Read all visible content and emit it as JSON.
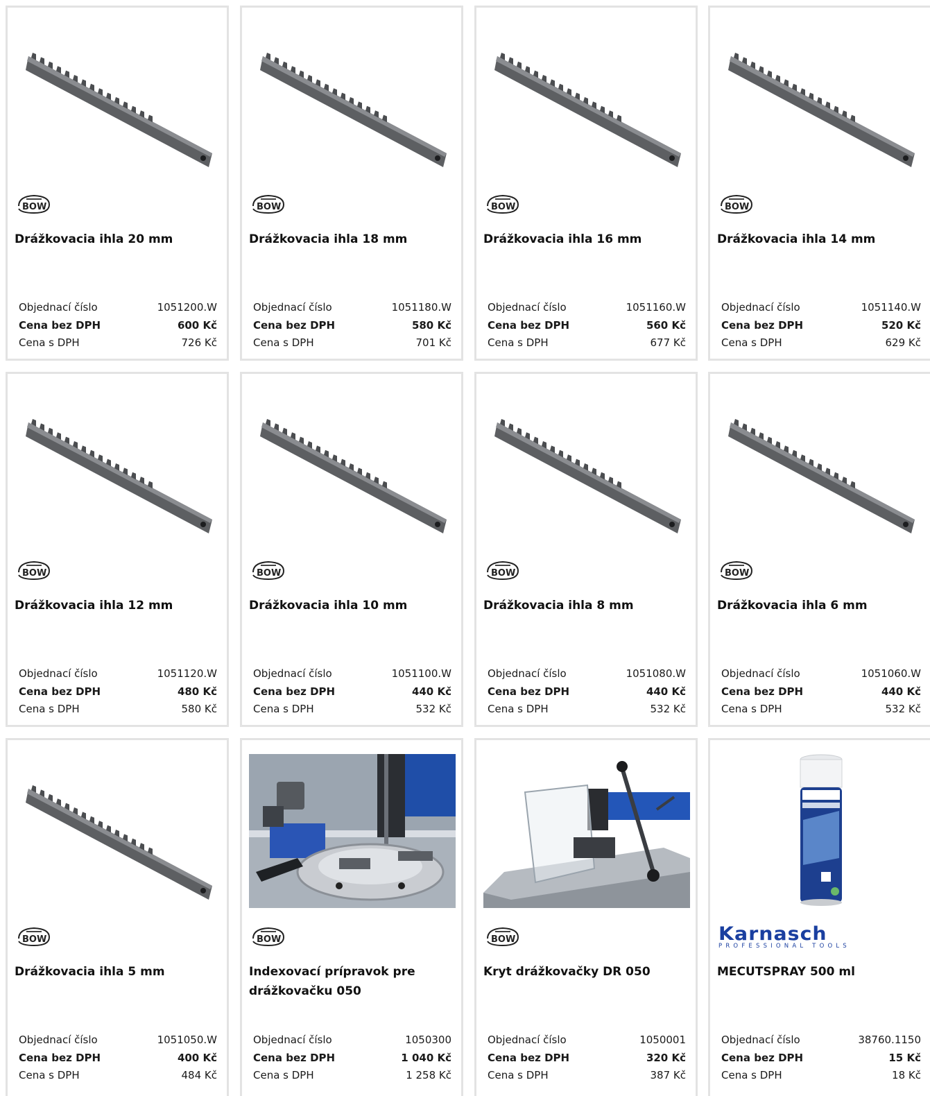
{
  "labels": {
    "order_number": "Objednací číslo",
    "price_no_vat": "Cena bez DPH",
    "price_vat": "Cena s DPH"
  },
  "products": [
    {
      "name": "Drážkovacia ihla 20 mm",
      "brand": "BOW",
      "image": "keyway-broach-image",
      "order": "1051200.W",
      "price": "600 Kč",
      "price_vat": "726 Kč"
    },
    {
      "name": "Drážkovacia ihla 18 mm",
      "brand": "BOW",
      "image": "keyway-broach-image",
      "order": "1051180.W",
      "price": "580 Kč",
      "price_vat": "701 Kč"
    },
    {
      "name": "Drážkovacia ihla 16 mm",
      "brand": "BOW",
      "image": "keyway-broach-image",
      "order": "1051160.W",
      "price": "560 Kč",
      "price_vat": "677 Kč"
    },
    {
      "name": "Drážkovacia ihla 14 mm",
      "brand": "BOW",
      "image": "keyway-broach-image",
      "order": "1051140.W",
      "price": "520 Kč",
      "price_vat": "629 Kč"
    },
    {
      "name": "Drážkovacia ihla 12 mm",
      "brand": "BOW",
      "image": "keyway-broach-image",
      "order": "1051120.W",
      "price": "480 Kč",
      "price_vat": "580 Kč"
    },
    {
      "name": "Drážkovacia ihla 10 mm",
      "brand": "BOW",
      "image": "keyway-broach-image",
      "order": "1051100.W",
      "price": "440 Kč",
      "price_vat": "532 Kč"
    },
    {
      "name": "Drážkovacia ihla 8 mm",
      "brand": "BOW",
      "image": "keyway-broach-image",
      "order": "1051080.W",
      "price": "440 Kč",
      "price_vat": "532 Kč"
    },
    {
      "name": "Drážkovacia ihla 6 mm",
      "brand": "BOW",
      "image": "keyway-broach-image",
      "order": "1051060.W",
      "price": "440 Kč",
      "price_vat": "532 Kč"
    },
    {
      "name": "Drážkovacia ihla 5 mm",
      "brand": "BOW",
      "image": "keyway-broach-image",
      "order": "1051050.W",
      "price": "400 Kč",
      "price_vat": "484 Kč"
    },
    {
      "name": "Indexovací prípravok pre drážkovačku 050",
      "brand": "BOW",
      "image": "indexing-fixture-image",
      "order": "1050300",
      "price": "1 040 Kč",
      "price_vat": "1 258 Kč"
    },
    {
      "name": "Kryt drážkovačky DR 050",
      "brand": "BOW",
      "image": "guard-cover-image",
      "order": "1050001",
      "price": "320 Kč",
      "price_vat": "387 Kč"
    },
    {
      "name": "MECUTSPRAY 500 ml",
      "brand": "Karnasch",
      "image": "spray-can-image",
      "order": "38760.1150",
      "price": "15 Kč",
      "price_vat": "18 Kč"
    }
  ],
  "karnasch_logo": {
    "line1": "Karnasch",
    "line2": "PROFESSIONAL TOOLS"
  },
  "colors": {
    "border": "#e3e3e3",
    "karnasch_blue": "#1a3fa0",
    "text": "#111111"
  }
}
